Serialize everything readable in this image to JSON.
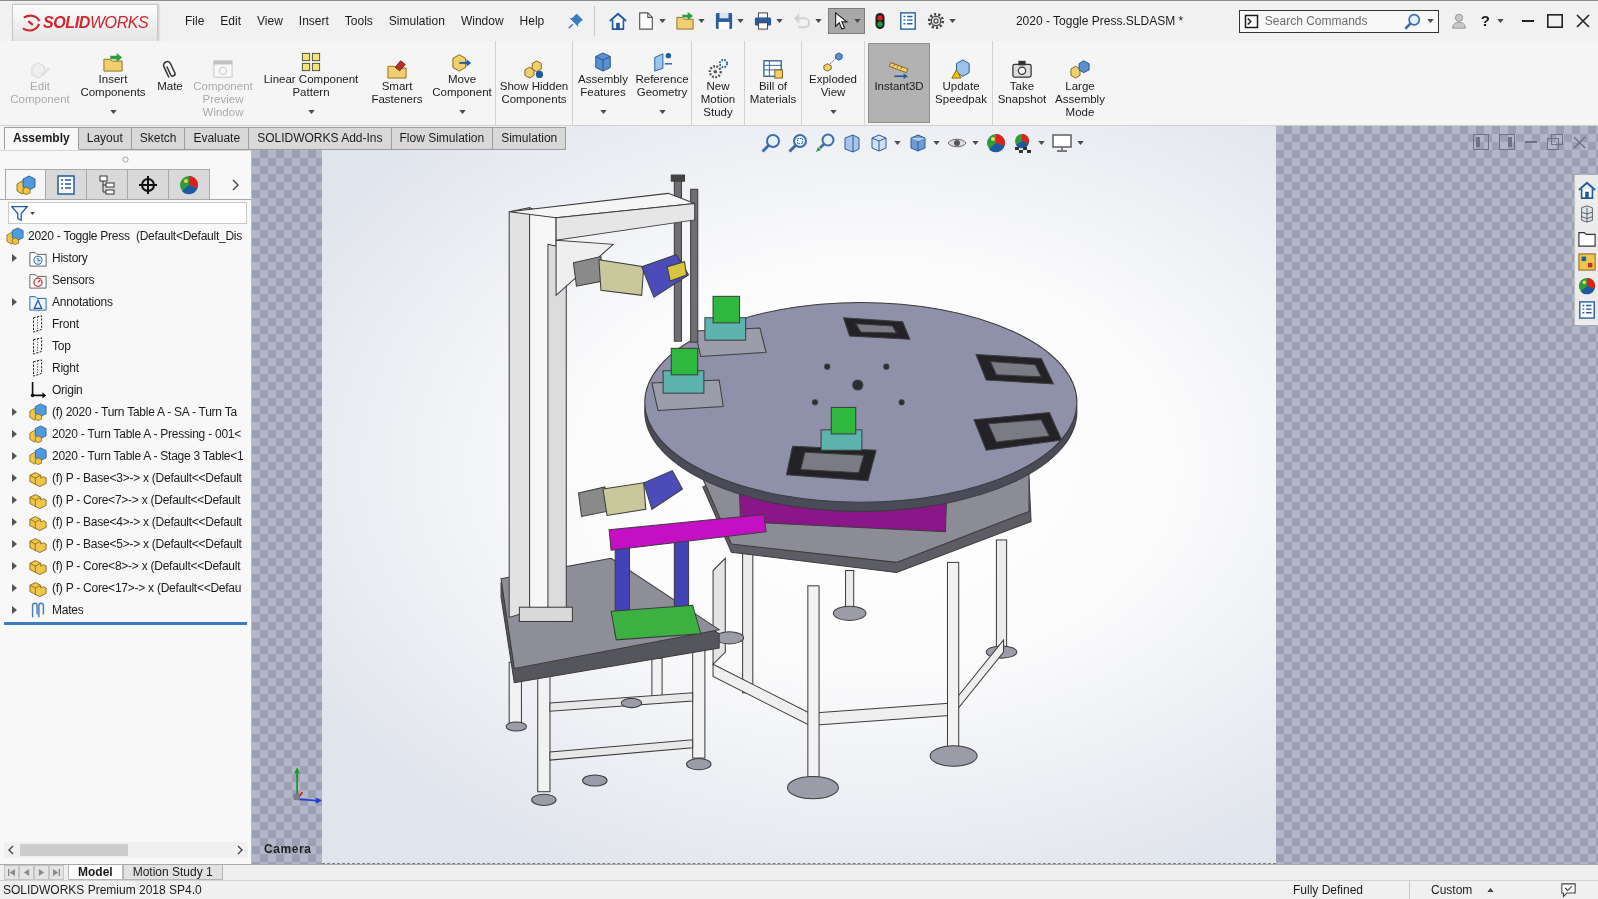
{
  "titlebar": {
    "logo": "**SOLID**WORKS",
    "menu": [
      "File",
      "Edit",
      "View",
      "Insert",
      "Tools",
      "Simulation",
      "Window",
      "Help"
    ],
    "quick_access": [
      {
        "dropdown": false,
        "selected": false,
        "disabled": false
      },
      {
        "dropdown": true,
        "selected": false,
        "disabled": false
      },
      {
        "dropdown": true,
        "selected": false,
        "disabled": false
      },
      {
        "dropdown": true,
        "selected": false,
        "disabled": false
      },
      {
        "dropdown": true,
        "selected": false,
        "disabled": false
      },
      {
        "dropdown": true,
        "selected": false,
        "disabled": true
      },
      {
        "dropdown": true,
        "selected": true,
        "disabled": false
      },
      {
        "dropdown": false,
        "selected": false,
        "disabled": false
      },
      {
        "dropdown": false,
        "selected": false,
        "disabled": false
      },
      {
        "dropdown": true,
        "selected": false,
        "disabled": false
      }
    ],
    "document_title": "2020 - Toggle Press.SLDASM *",
    "search": {
      "placeholder": "Search Commands"
    },
    "help": "?"
  },
  "ribbon_groups": [
    {
      "items": [
        {
          "label": "Edit Component",
          "disabled": true,
          "dropdown": false,
          "selected": false
        },
        {
          "label": "Insert Components",
          "disabled": false,
          "dropdown": true,
          "selected": false
        },
        {
          "label": "Mate",
          "disabled": false,
          "dropdown": false,
          "selected": false
        },
        {
          "label": "Component Preview Window",
          "disabled": true,
          "dropdown": false,
          "selected": false
        },
        {
          "label": "Linear Component Pattern",
          "disabled": false,
          "dropdown": true,
          "selected": false
        },
        {
          "label": "Smart Fasteners",
          "disabled": false,
          "dropdown": false,
          "selected": false
        },
        {
          "label": "Move Component",
          "disabled": false,
          "dropdown": true,
          "selected": false
        }
      ]
    },
    {
      "items": [
        {
          "label": "Show Hidden Components",
          "disabled": false,
          "dropdown": false,
          "selected": false
        }
      ]
    },
    {
      "items": [
        {
          "label": "Assembly Features",
          "disabled": false,
          "dropdown": true,
          "selected": false
        },
        {
          "label": "Reference Geometry",
          "disabled": false,
          "dropdown": true,
          "selected": false
        }
      ]
    },
    {
      "items": [
        {
          "label": "New Motion Study",
          "disabled": false,
          "dropdown": false,
          "selected": false
        }
      ]
    },
    {
      "items": [
        {
          "label": "Bill of Materials",
          "disabled": false,
          "dropdown": false,
          "selected": false
        }
      ]
    },
    {
      "items": [
        {
          "label": "Exploded View",
          "disabled": false,
          "dropdown": true,
          "selected": false
        }
      ]
    },
    {
      "items": [
        {
          "label": "Instant3D",
          "disabled": false,
          "dropdown": false,
          "selected": true
        },
        {
          "label": "Update Speedpak",
          "disabled": false,
          "dropdown": false,
          "selected": false
        }
      ]
    },
    {
      "items": [
        {
          "label": "Take Snapshot",
          "disabled": false,
          "dropdown": false,
          "selected": false
        },
        {
          "label": "Large Assembly Mode",
          "disabled": false,
          "dropdown": false,
          "selected": false
        }
      ]
    }
  ],
  "command_tabs": [
    {
      "label": "Assembly",
      "selected": true
    },
    {
      "label": "Layout",
      "selected": false
    },
    {
      "label": "Sketch",
      "selected": false
    },
    {
      "label": "Evaluate",
      "selected": false
    },
    {
      "label": "SOLIDWORKS Add-Ins",
      "selected": false
    },
    {
      "label": "Flow Simulation",
      "selected": false
    },
    {
      "label": "Simulation",
      "selected": false
    }
  ],
  "feature_manager": {
    "tabs": [
      {
        "selected": true
      },
      {
        "selected": false
      },
      {
        "selected": false
      },
      {
        "selected": false
      },
      {
        "selected": false
      }
    ],
    "tree": {
      "label": "2020 - Toggle Press  (Default<Default_Dis",
      "kind": "assembly",
      "children": [
        {
          "label": "History",
          "kind": "history",
          "expandable": true
        },
        {
          "label": "Sensors",
          "kind": "sensors",
          "expandable": false
        },
        {
          "label": "Annotations",
          "kind": "annotations",
          "expandable": true
        },
        {
          "label": "Front",
          "kind": "plane",
          "expandable": false
        },
        {
          "label": "Top",
          "kind": "plane",
          "expandable": false
        },
        {
          "label": "Right",
          "kind": "plane",
          "expandable": false
        },
        {
          "label": "Origin",
          "kind": "origin",
          "expandable": false
        },
        {
          "label": "(f) 2020 - Turn Table A - SA - Turn Ta",
          "kind": "assembly",
          "expandable": true
        },
        {
          "label": "2020 - Turn Table A - Pressing - 001<",
          "kind": "assembly",
          "expandable": true
        },
        {
          "label": "2020 - Turn Table A - Stage 3 Table<1",
          "kind": "assembly",
          "expandable": true
        },
        {
          "label": "(f) P - Base<3>-> x (Default<<Default",
          "kind": "part",
          "expandable": true
        },
        {
          "label": "(f) P - Core<7>-> x (Default<<Default",
          "kind": "part",
          "expandable": true
        },
        {
          "label": "(f) P - Base<4>-> x (Default<<Default",
          "kind": "part",
          "expandable": true
        },
        {
          "label": "(f) P - Base<5>-> x (Default<<Default",
          "kind": "part",
          "expandable": true
        },
        {
          "label": "(f) P - Core<8>-> x (Default<<Default",
          "kind": "part",
          "expandable": true
        },
        {
          "label": "(f) P - Core<17>-> x (Default<<Defau",
          "kind": "part",
          "expandable": true
        },
        {
          "label": "Mates",
          "kind": "mates",
          "expandable": true
        }
      ]
    }
  },
  "view_toolbar": [
    {
      "dropdown": false
    },
    {
      "dropdown": false
    },
    {
      "dropdown": false
    },
    {
      "dropdown": false
    },
    {
      "dropdown": true
    },
    {
      "dropdown": true
    },
    {
      "dropdown": true
    },
    {
      "dropdown": false
    },
    {
      "dropdown": true
    },
    {
      "dropdown": true
    }
  ],
  "viewport": {
    "camera_label": "Camera"
  },
  "bottom_tabs": [
    {
      "label": "Model",
      "selected": true
    },
    {
      "label": "Motion Study 1",
      "selected": false
    }
  ],
  "status_bar": {
    "product": "SOLIDWORKS Premium 2018 SP4.0",
    "status": "Fully Defined",
    "units": "Custom"
  }
}
